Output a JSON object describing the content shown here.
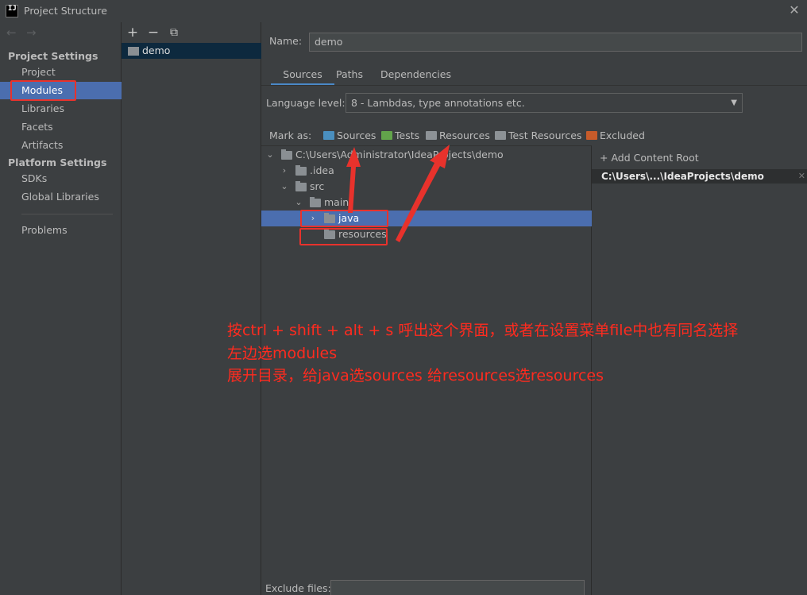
{
  "window": {
    "title": "Project Structure",
    "logo_text": "IJ"
  },
  "nav": {
    "back": "←",
    "forward": "→",
    "project_settings_header": "Project Settings",
    "platform_settings_header": "Platform Settings",
    "items": {
      "project": "Project",
      "modules": "Modules",
      "libraries": "Libraries",
      "facets": "Facets",
      "artifacts": "Artifacts",
      "sdks": "SDKs",
      "global_libraries": "Global Libraries",
      "problems": "Problems"
    },
    "selected": "Modules"
  },
  "modules_list": {
    "tools": {
      "add": "+",
      "remove": "−",
      "copy": "⧉"
    },
    "module_name": "demo"
  },
  "module": {
    "name_label": "Name:",
    "name_value": "demo",
    "tabs": [
      "Sources",
      "Paths",
      "Dependencies"
    ],
    "active_tab": "Sources",
    "language_level_label": "Language level:",
    "language_level_value": "8 - Lambdas, type annotations etc.",
    "mark_as_label": "Mark as:",
    "mark_options": [
      "Sources",
      "Tests",
      "Resources",
      "Test Resources",
      "Excluded"
    ],
    "mark_colors": [
      "#4a8fbf",
      "#62a44b",
      "#8d9296",
      "#8d9296",
      "#c75b2a"
    ],
    "tree": {
      "root": "C:\\Users\\Administrator\\IdeaProjects\\demo",
      "idea": ".idea",
      "src": "src",
      "main": "main",
      "java": "java",
      "resources": "resources"
    },
    "add_content_root": "+ Add Content Root",
    "content_root": "C:\\Users\\...\\IdeaProjects\\demo",
    "exclude_files_label": "Exclude files:"
  },
  "annotation": {
    "line1": "按ctrl + shift + alt + s 呼出这个界面，或者在设置菜单file中也有同名选择",
    "line2": "左边选modules",
    "line3": "展开目录，给java选sources  给resources选resources",
    "color": "#ff2b1f"
  }
}
